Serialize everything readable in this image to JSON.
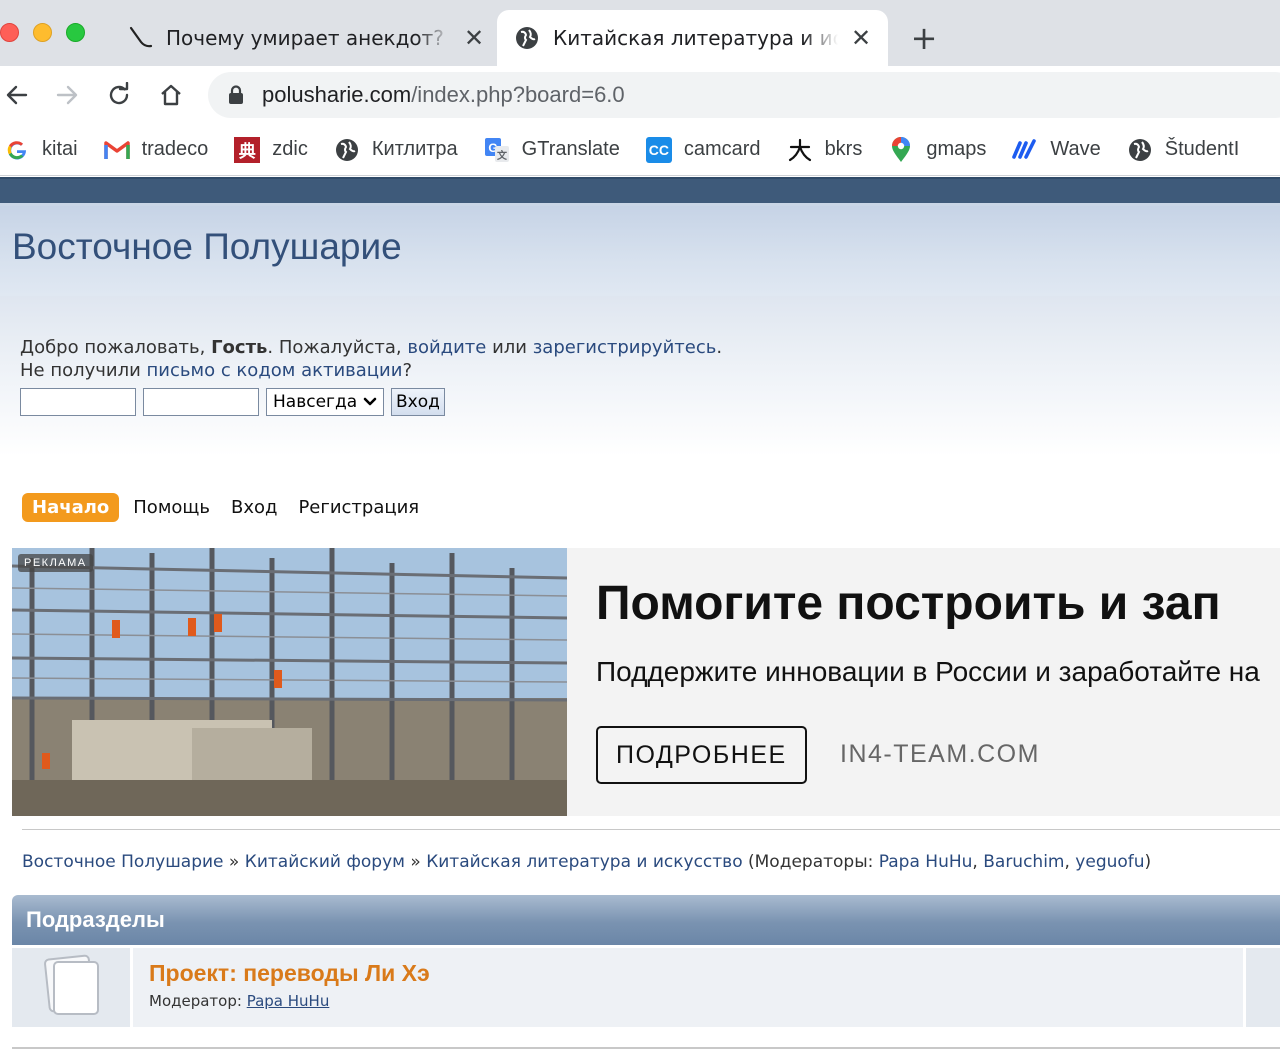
{
  "browser": {
    "tabs": [
      {
        "title": "Почему умирает анекдот? Ис",
        "active": false,
        "favicon": "pen-icon"
      },
      {
        "title": "Китайская литература и иску",
        "active": true,
        "favicon": "globe-icon"
      }
    ],
    "close_glyph": "✕",
    "new_tab_glyph": "+",
    "url_host": "polusharie.com",
    "url_path": "/index.php?board=6.0",
    "bookmarks": [
      {
        "label": "kitai",
        "icon": "google-icon"
      },
      {
        "label": "tradeco",
        "icon": "gmail-icon"
      },
      {
        "label": "zdic",
        "icon": "zdic-icon"
      },
      {
        "label": "Китлитра",
        "icon": "globe-icon"
      },
      {
        "label": "GTranslate",
        "icon": "translate-icon"
      },
      {
        "label": "camcard",
        "icon": "camcard-icon"
      },
      {
        "label": "bkrs",
        "icon": "bkrs-icon"
      },
      {
        "label": "gmaps",
        "icon": "maps-pin-icon"
      },
      {
        "label": "Wave",
        "icon": "wave-icon"
      },
      {
        "label": "ŠtudentI",
        "icon": "globe-icon"
      }
    ]
  },
  "forum": {
    "title": "Восточное Полушарие",
    "welcome": {
      "prefix": "Добро пожаловать, ",
      "guest": "Гость",
      "mid": ". Пожалуйста, ",
      "login_link": "войдите",
      "or": " или ",
      "register_link": "зарегистрируйтесь",
      "end": ".",
      "line2_prefix": "Не получили ",
      "activation_link": "письмо с кодом активации",
      "line2_end": "?"
    },
    "login": {
      "duration": "Навсегда",
      "button": "Вход"
    },
    "menu": {
      "home": "Начало",
      "help": "Помощь",
      "login": "Вход",
      "register": "Регистрация"
    },
    "ad": {
      "tag": "РЕКЛАМА",
      "headline": "Помогите построить и зап",
      "sub": "Поддержите инновации в России и заработайте на",
      "button": "ПОДРОБНЕЕ",
      "domain": "IN4-TEAM.COM"
    },
    "breadcrumb": {
      "items": [
        "Восточное Полушарие",
        "Китайский форум",
        "Китайская литература и искусство"
      ],
      "separator": " » ",
      "moderators_prefix": " (Модераторы: ",
      "moderators": [
        "Papa HuHu",
        "Baruchim",
        "yeguofu"
      ],
      "moderators_suffix": ")"
    },
    "category": {
      "title": "Подразделы",
      "boards": [
        {
          "name": "Проект: переводы Ли Хэ",
          "moderator_label": "Модератор: ",
          "moderator": "Papa HuHu"
        }
      ]
    }
  },
  "colors": {
    "accent_orange": "#f39a1d",
    "link_blue": "#2a4a7e",
    "header_blue": "#3e5a7a"
  }
}
